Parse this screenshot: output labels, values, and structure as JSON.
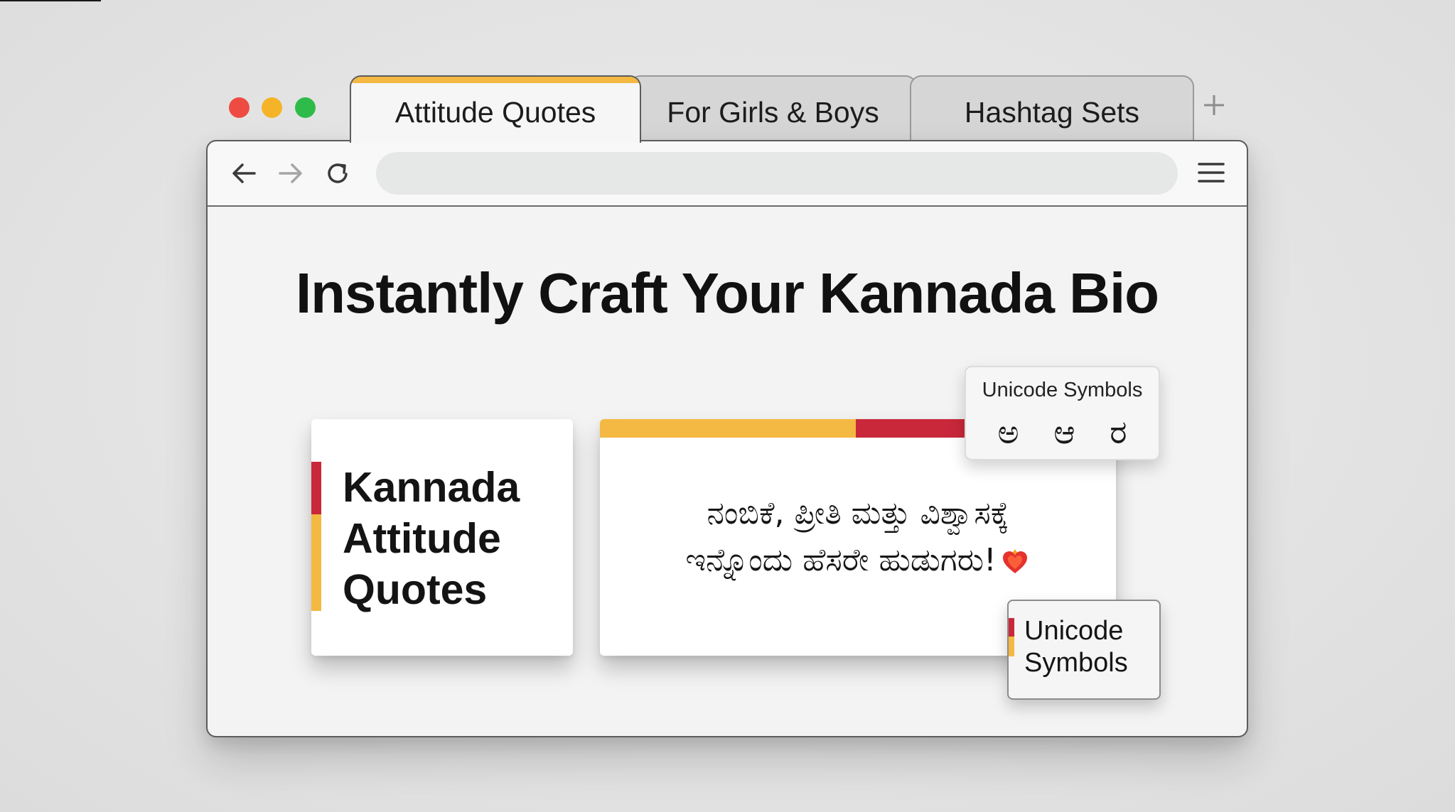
{
  "tabs": [
    {
      "label": "Attitude Quotes",
      "active": true
    },
    {
      "label": "For Girls & Boys",
      "active": false
    },
    {
      "label": "Hashtag Sets",
      "active": false
    }
  ],
  "new_tab_icon": "plus-icon",
  "toolbar": {
    "back_icon": "arrow-left-icon",
    "forward_icon": "arrow-right-icon",
    "reload_icon": "reload-icon",
    "address_value": "",
    "menu_icon": "hamburger-menu-icon"
  },
  "headline": "Instantly Craft Your Kannada Bio",
  "left_card": {
    "title": "Kannada\nAttitude\nQuotes"
  },
  "center_card": {
    "quote_line1": "ನಂಬಿಕೆ, ಪ್ರೀತಿ ಮತ್ತು ವಿಶ್ವಾಸಕ್ಕೆ",
    "quote_line2": "ಇನ್ನೊಂದು ಹೆಸರೇ ಹುಡುಗರು!",
    "emoji_icon": "heart-on-fire-icon"
  },
  "symbols_popup": {
    "title": "Unicode Symbols",
    "glyphs": [
      "ಅ",
      "ಆ",
      "ರ"
    ]
  },
  "symbols_badge": {
    "label": "Unicode\nSymbols"
  },
  "colors": {
    "accent_yellow": "#f4b942",
    "accent_red": "#c8283a",
    "close_button": "#ee4b43",
    "minimize_button": "#f5b428",
    "maximize_button": "#2fbb49"
  }
}
